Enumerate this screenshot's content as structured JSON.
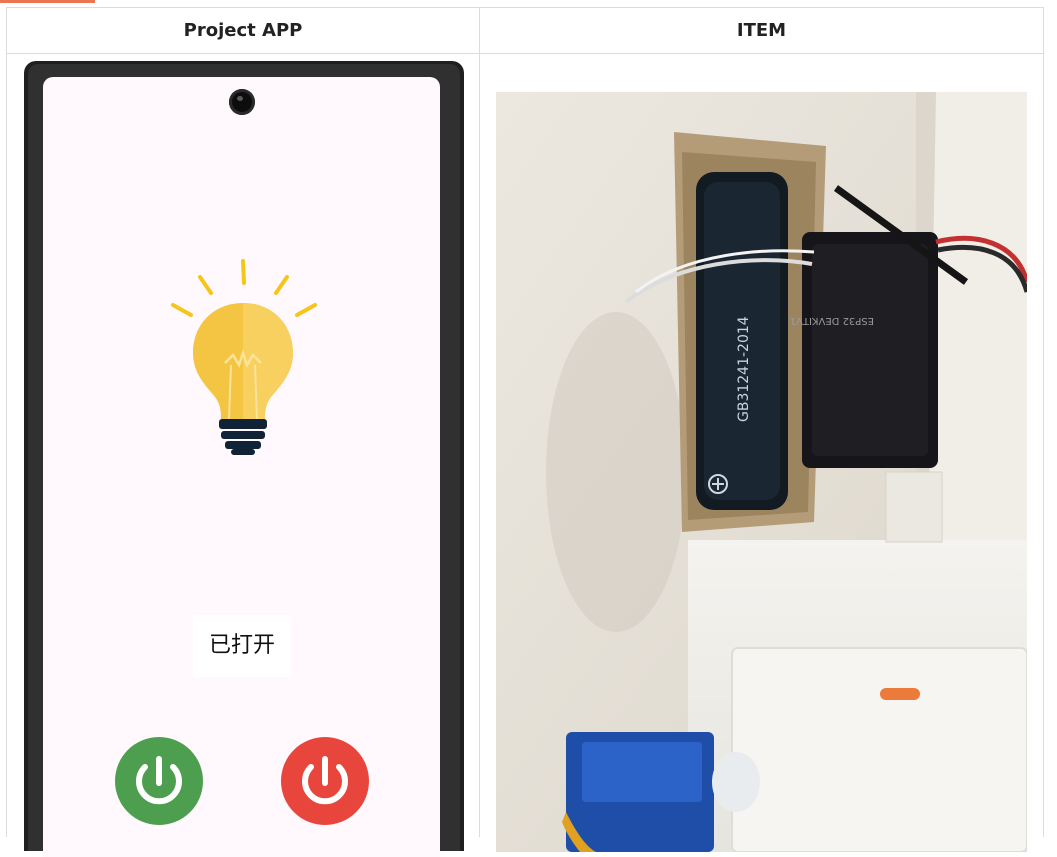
{
  "table": {
    "headers": [
      "Project APP",
      "ITEM"
    ]
  },
  "app": {
    "status_text": "已打开"
  },
  "colors": {
    "accent": "#ea7550",
    "power_on": "#4d9f4f",
    "power_off": "#e8453c",
    "bulb_yellow": "#f4c542",
    "bulb_base": "#0f2236"
  },
  "icons": {
    "bulb": "lightbulb-icon",
    "power": "power-icon"
  }
}
